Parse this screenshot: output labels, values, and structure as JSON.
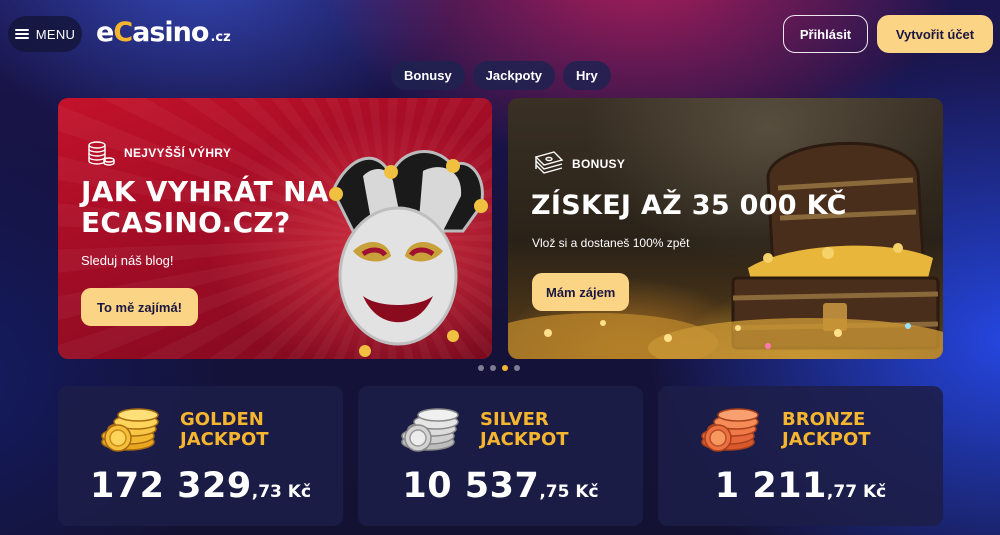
{
  "header": {
    "menu_label": "MENU",
    "logo": {
      "main_pre": "e",
      "main_c": "C",
      "main_post": "asino",
      "tld": ".cz"
    },
    "login_label": "Přihlásit",
    "register_label": "Vytvořit účet"
  },
  "nav": {
    "bonusy": "Bonusy",
    "jackpoty": "Jackpoty",
    "hry": "Hry"
  },
  "banners": [
    {
      "tag": "NEJVYŠŠÍ VÝHRY",
      "title_line1": "JAK VYHRÁT NA",
      "title_line2": "ECASINO.CZ?",
      "subtitle": "Sleduj náš blog!",
      "button": "To mě zajímá!"
    },
    {
      "tag": "BONUSY",
      "title": "ZÍSKEJ AŽ 35 000 KČ",
      "subtitle": "Vlož si a dostaneš 100% zpět",
      "button": "Mám zájem"
    }
  ],
  "carousel": {
    "count": 4,
    "active_index": 2
  },
  "jackpots": [
    {
      "line1": "GOLDEN",
      "line2": "JACKPOT",
      "amount_main": "172 329",
      "amount_decimal": ",73 Kč"
    },
    {
      "line1": "SILVER",
      "line2": "JACKPOT",
      "amount_main": "10 537",
      "amount_decimal": ",75 Kč"
    },
    {
      "line1": "BRONZE",
      "line2": "JACKPOT",
      "amount_main": "1 211",
      "amount_decimal": ",77 Kč"
    }
  ],
  "colors": {
    "accent_gold": "#f5b52e",
    "button_yellow": "#fcd486",
    "silver_coin": "#d9d9d9",
    "bronze_coin": "#e86a3a"
  },
  "icons": {
    "menu": "hamburger-icon",
    "banner1_tag": "coin-stack-icon",
    "banner2_tag": "cash-stack-icon"
  }
}
